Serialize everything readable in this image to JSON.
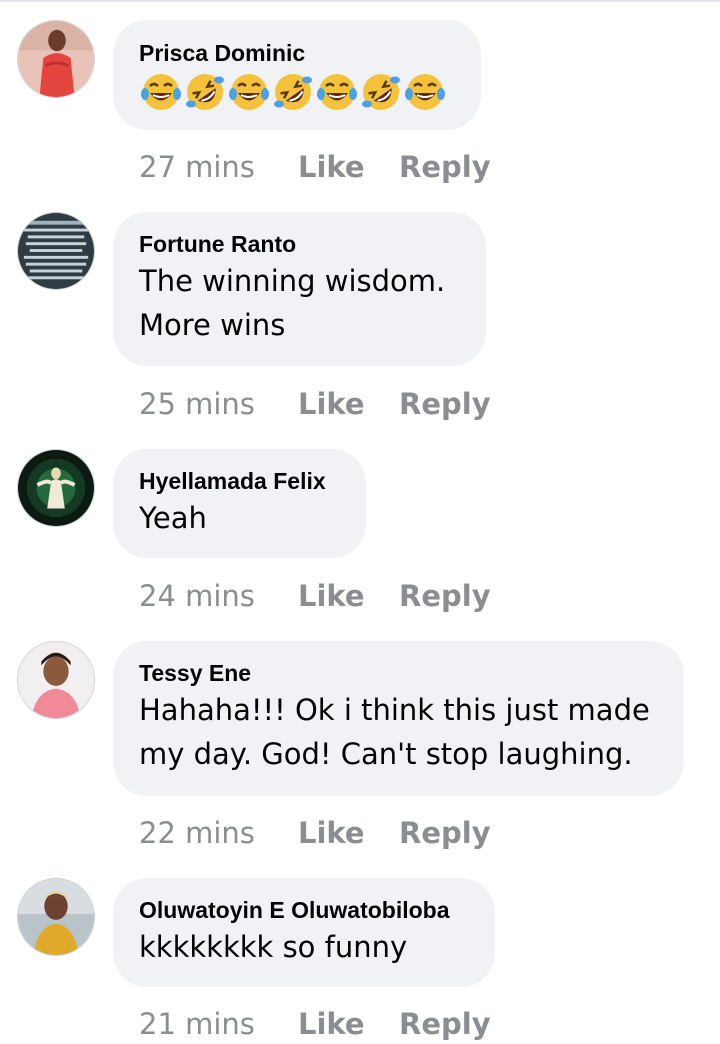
{
  "comments": [
    {
      "author": "Prisca Dominic",
      "text": "",
      "emojis": [
        "laughing-tears",
        "rolling-laughing",
        "laughing-tears",
        "rolling-laughing",
        "laughing-tears",
        "rolling-laughing",
        "laughing-tears"
      ],
      "time": "27 mins",
      "like": "Like",
      "reply": "Reply"
    },
    {
      "author": "Fortune Ranto",
      "text_lines": [
        "The winning wisdom.",
        "More wins"
      ],
      "time": "25 mins",
      "like": "Like",
      "reply": "Reply"
    },
    {
      "author": "Hyellamada Felix",
      "text_lines": [
        "Yeah"
      ],
      "time": "24 mins",
      "like": "Like",
      "reply": "Reply"
    },
    {
      "author": "Tessy Ene",
      "text_lines": [
        "Hahaha!!! Ok i think this just made",
        "my day. God! Can't stop laughing."
      ],
      "time": "22 mins",
      "like": "Like",
      "reply": "Reply"
    },
    {
      "author": "Oluwatoyin E Oluwatobiloba",
      "text_lines": [
        "kkkkkkkk so funny"
      ],
      "time": "21 mins",
      "like": "Like",
      "reply": "Reply"
    }
  ],
  "colors": {
    "bubble": "#f0f2f5",
    "meta": "#8a8d91",
    "text": "#050505"
  }
}
